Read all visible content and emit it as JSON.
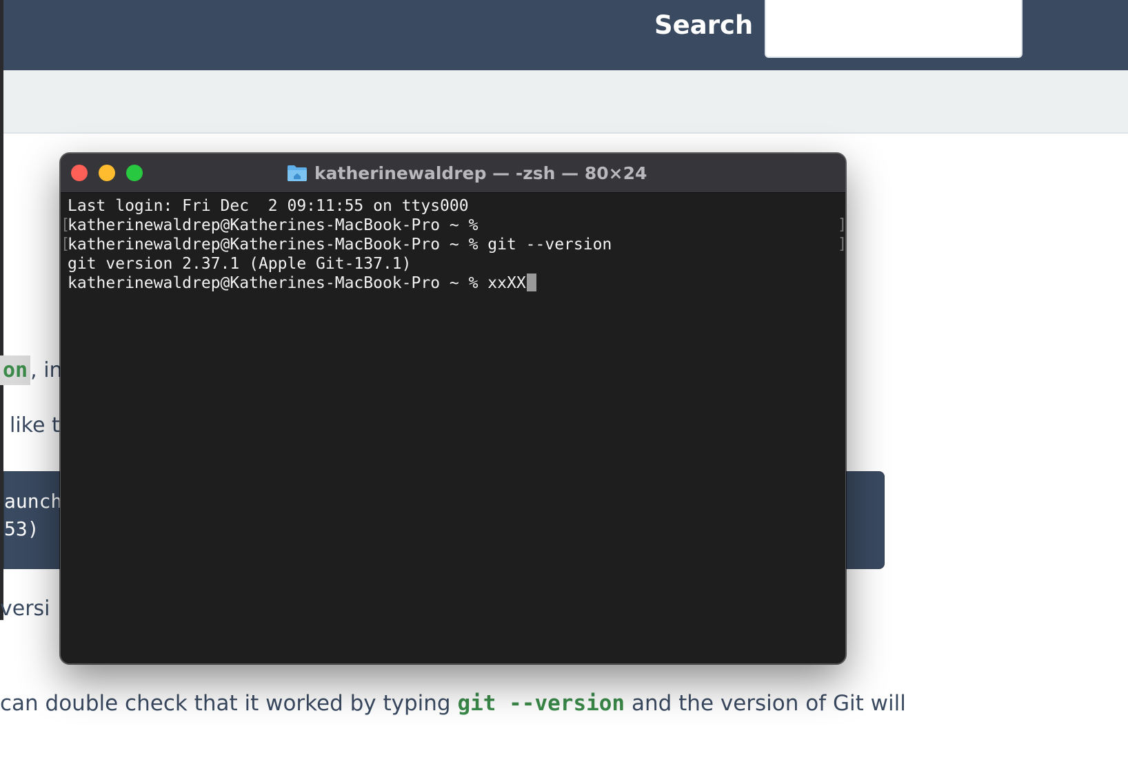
{
  "header": {
    "search_label": "Search",
    "search_value": ""
  },
  "article": {
    "inline_code_fragment": "on",
    "after_code_text": ", in t",
    "like_text": "like th",
    "code_block_lines": [
      "aunche",
      "53)"
    ],
    "versi_text": "versi",
    "bottom_prefix": "can double check that it worked by typing ",
    "bottom_code": "git --version",
    "bottom_suffix": " and the version of Git will"
  },
  "terminal": {
    "title": "katherinewaldrep — -zsh — 80×24",
    "lines": [
      "Last login: Fri Dec  2 09:11:55 on ttys000",
      "katherinewaldrep@Katherines-MacBook-Pro ~ %",
      "katherinewaldrep@Katherines-MacBook-Pro ~ % git --version",
      "git version 2.37.1 (Apple Git-137.1)",
      "katherinewaldrep@Katherines-MacBook-Pro ~ % xxXX"
    ],
    "bracket_left": "[",
    "bracket_right": "]"
  },
  "colors": {
    "header_bg": "#3a4a61",
    "code_green": "#3b8a4a",
    "terminal_bg": "#1e1e1e",
    "traffic_close": "#fe5f57",
    "traffic_minimize": "#febc2e",
    "traffic_maximize": "#28c840",
    "folder_blue": "#5fb0ea"
  },
  "icons": {
    "close": "close-icon",
    "minimize": "minimize-icon",
    "maximize": "maximize-icon",
    "folder": "home-folder-icon"
  }
}
